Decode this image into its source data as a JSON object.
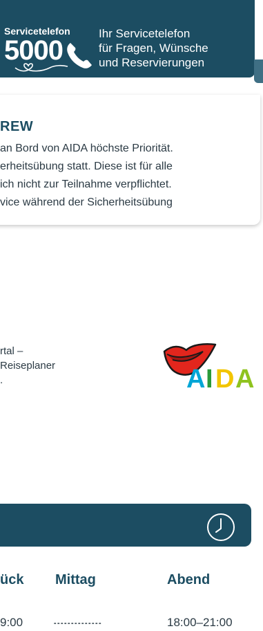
{
  "service_banner": {
    "label": "Servicetelefon",
    "number": "5000",
    "lines": [
      "Ihr Servicetelefon",
      "für Fragen, Wünsche",
      "und Reservierungen"
    ]
  },
  "safety": {
    "heading": "REW",
    "lines": [
      "an Bord von AIDA höchste Priorität.",
      "erheitsübung statt. Diese ist für alle",
      "ich nicht zur Teilnahme verpflichtet.",
      "vice während der Sicherheitsübung"
    ]
  },
  "portal": {
    "lines": [
      "rtal –",
      "Reiseplaner",
      "."
    ],
    "logo_text": "AIDA"
  },
  "times": {
    "columns": [
      "ück",
      "Mittag",
      "Abend"
    ],
    "row": [
      "9:00",
      "",
      "18:00–21:00"
    ]
  },
  "colors": {
    "brand_dark": "#1c4d62",
    "logo_red": "#e2261d",
    "logo_a1": "#00a6d6",
    "logo_i": "#2a9a3b",
    "logo_d": "#f2c500",
    "logo_a2": "#8fc31f"
  }
}
